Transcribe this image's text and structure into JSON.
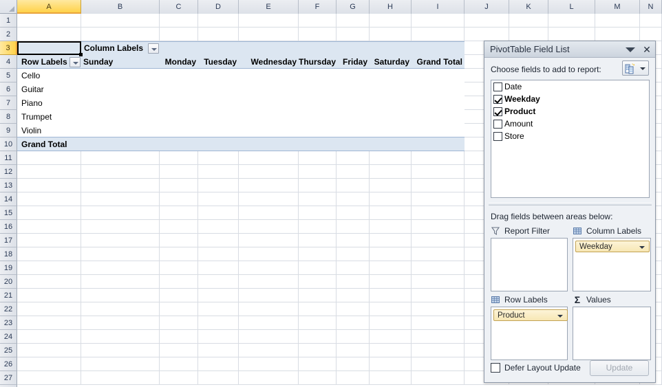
{
  "grid": {
    "columns": [
      "A",
      "B",
      "C",
      "D",
      "E",
      "F",
      "G",
      "H",
      "I",
      "J",
      "K",
      "L",
      "M",
      "N"
    ],
    "selected_column": "A",
    "rows": [
      "1",
      "2",
      "3",
      "4",
      "5",
      "6",
      "7",
      "8",
      "9",
      "10",
      "11",
      "12",
      "13",
      "14",
      "15",
      "16",
      "17",
      "18",
      "19",
      "20",
      "21",
      "22",
      "23",
      "24",
      "25",
      "26",
      "27"
    ],
    "selected_row": "3"
  },
  "pivot": {
    "column_labels_header": "Column Labels",
    "row_labels_header": "Row Labels",
    "column_headers": [
      "Sunday",
      "Monday",
      "Tuesday",
      "Wednesday",
      "Thursday",
      "Friday",
      "Saturday",
      "Grand Total"
    ],
    "row_items": [
      "Cello",
      "Guitar",
      "Piano",
      "Trumpet",
      "Violin"
    ],
    "grand_total_label": "Grand Total",
    "active_cell_ref": "A3",
    "active_cell_value": ""
  },
  "panel": {
    "title": "PivotTable Field List",
    "minimize_icon": "chevron-down-icon",
    "close_icon": "close-icon",
    "choose_fields_label": "Choose fields to add to report:",
    "field_list_button_icon": "field-list-icon",
    "fields": [
      {
        "name": "Date",
        "checked": false
      },
      {
        "name": "Weekday",
        "checked": true
      },
      {
        "name": "Product",
        "checked": true
      },
      {
        "name": "Amount",
        "checked": false
      },
      {
        "name": "Store",
        "checked": false
      }
    ],
    "drag_fields_label": "Drag fields between areas below:",
    "areas": [
      {
        "key": "report_filter",
        "label": "Report Filter",
        "icon": "funnel-icon",
        "items": []
      },
      {
        "key": "column_labels",
        "label": "Column Labels",
        "icon": "grid-icon",
        "items": [
          "Weekday"
        ]
      },
      {
        "key": "row_labels",
        "label": "Row Labels",
        "icon": "grid-icon",
        "items": [
          "Product"
        ]
      },
      {
        "key": "values",
        "label": "Values",
        "icon": "sigma-icon",
        "items": []
      }
    ],
    "defer_label": "Defer Layout Update",
    "defer_checked": false,
    "update_label": "Update",
    "update_enabled": false
  },
  "colors": {
    "header_selected": "#ffd24a",
    "pivot_band": "#dce6f1",
    "pill_fill": "#f7e7b4",
    "panel_bg": "#eef1f5"
  }
}
